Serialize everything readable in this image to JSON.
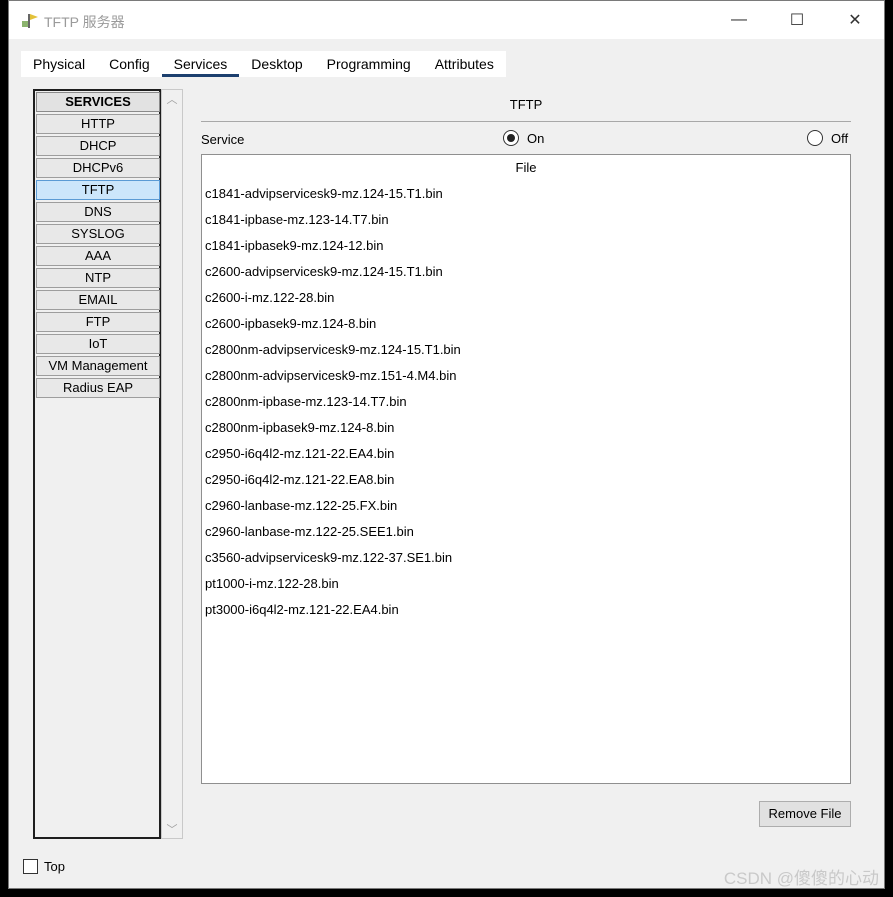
{
  "window": {
    "title": "TFTP 服务器",
    "controls": {
      "minimize": "—",
      "maximize": "☐",
      "close": "✕"
    }
  },
  "tabs": [
    {
      "label": "Physical",
      "active": false
    },
    {
      "label": "Config",
      "active": false
    },
    {
      "label": "Services",
      "active": true
    },
    {
      "label": "Desktop",
      "active": false
    },
    {
      "label": "Programming",
      "active": false
    },
    {
      "label": "Attributes",
      "active": false
    }
  ],
  "sidebar": {
    "header": "SERVICES",
    "items": [
      {
        "label": "HTTP",
        "selected": false
      },
      {
        "label": "DHCP",
        "selected": false
      },
      {
        "label": "DHCPv6",
        "selected": false
      },
      {
        "label": "TFTP",
        "selected": true
      },
      {
        "label": "DNS",
        "selected": false
      },
      {
        "label": "SYSLOG",
        "selected": false
      },
      {
        "label": "AAA",
        "selected": false
      },
      {
        "label": "NTP",
        "selected": false
      },
      {
        "label": "EMAIL",
        "selected": false
      },
      {
        "label": "FTP",
        "selected": false
      },
      {
        "label": "IoT",
        "selected": false
      },
      {
        "label": "VM Management",
        "selected": false
      },
      {
        "label": "Radius EAP",
        "selected": false
      }
    ]
  },
  "main": {
    "title": "TFTP",
    "service_label": "Service",
    "on_label": "On",
    "off_label": "Off",
    "service_state": "On",
    "file_header": "File",
    "files": [
      "c1841-advipservicesk9-mz.124-15.T1.bin",
      "c1841-ipbase-mz.123-14.T7.bin",
      "c1841-ipbasek9-mz.124-12.bin",
      "c2600-advipservicesk9-mz.124-15.T1.bin",
      "c2600-i-mz.122-28.bin",
      "c2600-ipbasek9-mz.124-8.bin",
      "c2800nm-advipservicesk9-mz.124-15.T1.bin",
      "c2800nm-advipservicesk9-mz.151-4.M4.bin",
      "c2800nm-ipbase-mz.123-14.T7.bin",
      "c2800nm-ipbasek9-mz.124-8.bin",
      "c2950-i6q4l2-mz.121-22.EA4.bin",
      "c2950-i6q4l2-mz.121-22.EA8.bin",
      "c2960-lanbase-mz.122-25.FX.bin",
      "c2960-lanbase-mz.122-25.SEE1.bin",
      "c3560-advipservicesk9-mz.122-37.SE1.bin",
      "pt1000-i-mz.122-28.bin",
      "pt3000-i6q4l2-mz.121-22.EA4.bin"
    ],
    "remove_button": "Remove File"
  },
  "footer": {
    "top_label": "Top",
    "top_checked": false
  },
  "watermark": "CSDN @傻傻的心动",
  "colors": {
    "active_tab_underline": "#1c3f6e",
    "selected_item_bg": "#cce6fb"
  }
}
